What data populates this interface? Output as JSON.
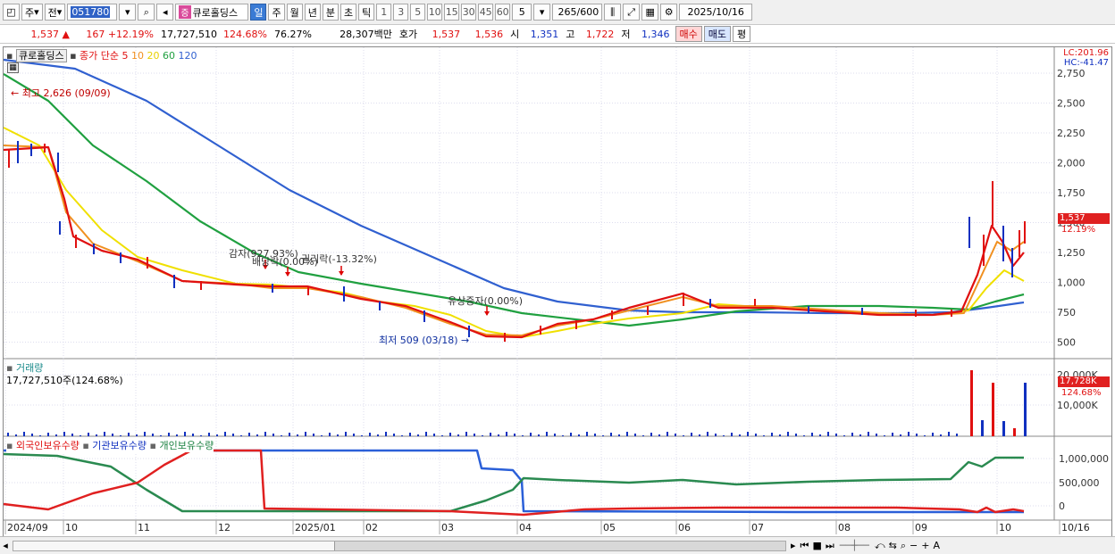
{
  "toolbar": {
    "market": "주",
    "prev": "전",
    "code": "051780",
    "tag": "증",
    "name": "큐로홀딩스",
    "periods": [
      "일",
      "주",
      "월",
      "년",
      "분",
      "초",
      "틱"
    ],
    "active_period": "일",
    "intervals": [
      "1",
      "3",
      "5",
      "10",
      "15",
      "30",
      "45",
      "60"
    ],
    "interval_value": "5",
    "count": "265",
    "count_total": "/600",
    "date": "2025/10/16"
  },
  "quote": {
    "price": "1,537",
    "change": "167",
    "change_pct": "+12.19%",
    "volume": "17,727,510",
    "vol_ratio": "124.68%",
    "turnover": "76.27%",
    "amount": "28,307백만",
    "hoga_label": "호가",
    "ask": "1,537",
    "bid": "1,536",
    "open_label": "시",
    "open": "1,351",
    "high_label": "고",
    "high": "1,722",
    "low_label": "저",
    "low": "1,346",
    "buy": "매수",
    "sell": "매도",
    "avg": "평"
  },
  "price_panel": {
    "legend_name": "큐로홀딩스",
    "legend_ma": "종가 단순",
    "ma_periods": [
      "5",
      "10",
      "20",
      "60",
      "120"
    ],
    "lc": "LC:201.96",
    "hc": "HC:-41.47",
    "y_ticks": [
      "2,750",
      "2,500",
      "2,250",
      "2,000",
      "1,750",
      "1,500",
      "1,250",
      "1,000",
      "750",
      "500"
    ],
    "last_price": "1,537",
    "last_pct": "12.19%",
    "annotations": {
      "high": "최고 2,626 (09/09)",
      "low": "최저 509 (03/18)",
      "a1": "감자(927.93%)",
      "a2": "배당락(0.00%)",
      "a3": "권리락(-13.32%)",
      "a4": "유상증자(0.00%)"
    }
  },
  "volume_panel": {
    "title": "거래량",
    "value": "17,727,510주(124.68%)",
    "y_ticks": [
      "20,000K",
      "10,000K"
    ],
    "last": "17,728K",
    "last_pct": "124.68%"
  },
  "holding_panel": {
    "legends": [
      "외국인보유수량",
      "기관보유수량",
      "개인보유수량"
    ],
    "y_ticks": [
      "1,000,000",
      "500,000",
      "0"
    ]
  },
  "x_axis": [
    "2024/09",
    "10",
    "11",
    "12",
    "2025/01",
    "02",
    "03",
    "04",
    "05",
    "06",
    "07",
    "08",
    "09",
    "10",
    "10/16"
  ],
  "colors": {
    "up": "#e01010",
    "down": "#1030c0",
    "ma5": "#e01010",
    "ma10": "#f09020",
    "ma20": "#f0e000",
    "ma60": "#20a040",
    "ma120": "#3060d0"
  }
}
